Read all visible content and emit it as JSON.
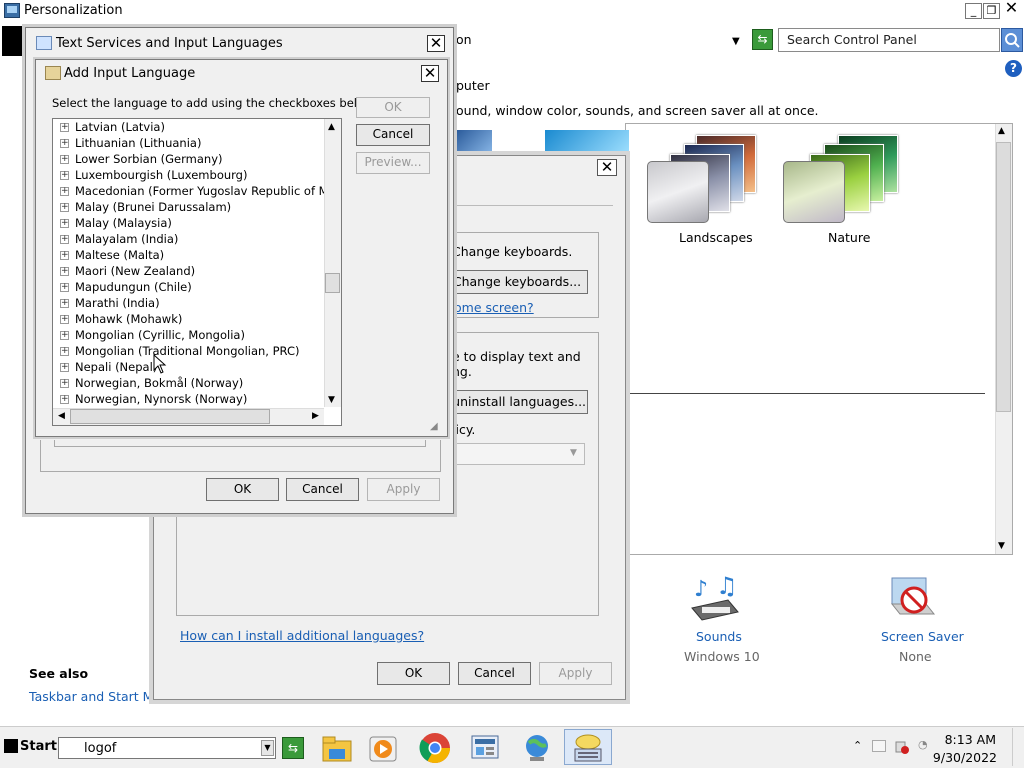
{
  "main_window": {
    "title": "Personalization",
    "minimize": "_",
    "maximize": "❐",
    "close": "✕",
    "address_fragment": "on",
    "search_placeholder": "Search Control Panel",
    "heading_fragment": "puter",
    "desc_fragment": "ound, window color, sounds, and screen saver all at once.",
    "themes": [
      {
        "label": "Landscapes"
      },
      {
        "label": "Nature"
      }
    ],
    "see_also": "See also",
    "taskbar_link": "Taskbar and Start Menu",
    "bottom_icons": [
      {
        "label": "Sounds",
        "sub": "Windows 10",
        "icon": "sounds-icon"
      },
      {
        "label": "Screen Saver",
        "sub": "None",
        "icon": "screen-saver-icon"
      }
    ]
  },
  "keyboard_dialog": {
    "change_keyboards_text": "Change keyboards.",
    "change_keyboards_button": "Change keyboards...",
    "welcome_link_fragment": "ome screen?",
    "display_text_line1": "e to display text and",
    "display_text_line2": "ng.",
    "uninstall_button": "/uninstall languages...",
    "policy_fragment": "licy.",
    "install_link": "How can I install additional languages?",
    "ok": "OK",
    "cancel": "Cancel",
    "apply": "Apply"
  },
  "text_services_dialog": {
    "title": "Text Services and Input Languages",
    "close": "✕",
    "ok": "OK",
    "cancel": "Cancel",
    "apply": "Apply"
  },
  "add_language_dialog": {
    "title": "Add Input Language",
    "close": "✕",
    "instruction": "Select the language to add using the checkboxes below.",
    "ok": "OK",
    "cancel": "Cancel",
    "preview": "Preview...",
    "languages": [
      "Latvian (Latvia)",
      "Lithuanian (Lithuania)",
      "Lower Sorbian (Germany)",
      "Luxembourgish (Luxembourg)",
      "Macedonian (Former Yugoslav Republic of Mace",
      "Malay (Brunei Darussalam)",
      "Malay (Malaysia)",
      "Malayalam (India)",
      "Maltese (Malta)",
      "Maori (New Zealand)",
      "Mapudungun (Chile)",
      "Marathi (India)",
      "Mohawk (Mohawk)",
      "Mongolian (Cyrillic, Mongolia)",
      "Mongolian (Traditional Mongolian, PRC)",
      "Nepali (Nepal)",
      "Norwegian, Bokmål (Norway)",
      "Norwegian, Nynorsk (Norway)"
    ]
  },
  "taskbar": {
    "start": "Start",
    "run_value": "logof",
    "time": "8:13 AM",
    "date": "9/30/2022",
    "pinned": [
      "file-explorer-icon",
      "media-player-icon",
      "chrome-icon",
      "control-panel-icon",
      "network-globe-icon",
      "keyboard-icon"
    ]
  }
}
